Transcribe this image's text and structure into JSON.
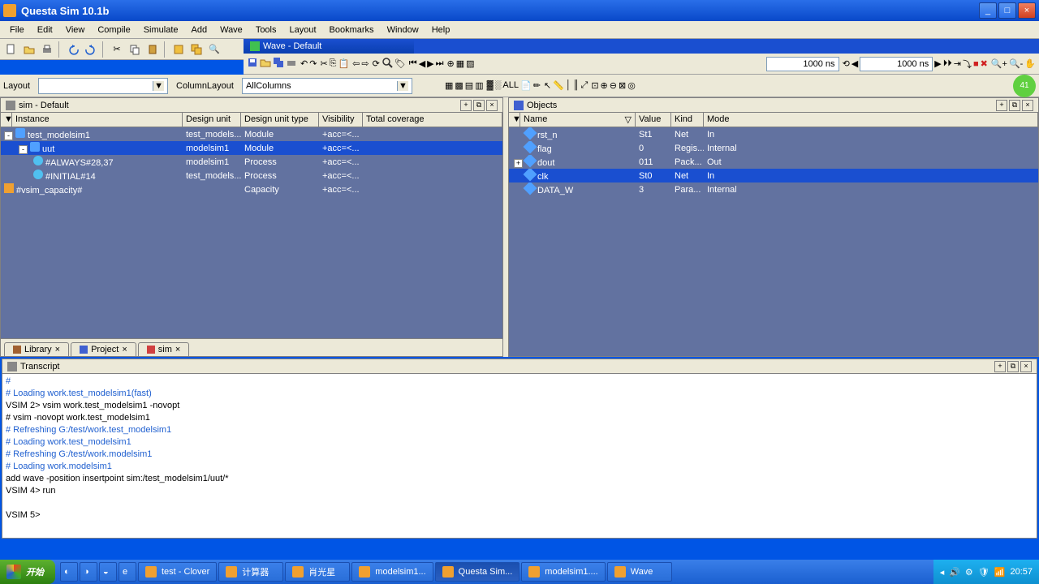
{
  "window": {
    "title": "Questa Sim 10.1b"
  },
  "menu": [
    "File",
    "Edit",
    "View",
    "Compile",
    "Simulate",
    "Add",
    "Wave",
    "Tools",
    "Layout",
    "Bookmarks",
    "Window",
    "Help"
  ],
  "wave_tab": "Wave - Default",
  "time_field_top": "1000 ns",
  "time_field_toolbar": "1000 ns",
  "layout_label": "Layout",
  "layout_value": "",
  "column_layout_label": "ColumnLayout",
  "column_layout_value": "AllColumns",
  "sim_panel": {
    "title": "sim - Default",
    "cols": [
      "Instance",
      "Design unit",
      "Design unit type",
      "Visibility",
      "Total coverage"
    ],
    "rows": [
      {
        "indent": 0,
        "exp": "-",
        "icon": "mod",
        "name": "test_modelsim1",
        "du": "test_models...",
        "dt": "Module",
        "vis": "+acc=<...",
        "sel": false
      },
      {
        "indent": 1,
        "exp": "-",
        "icon": "mod",
        "name": "uut",
        "du": "modelsim1",
        "dt": "Module",
        "vis": "+acc=<...",
        "sel": true
      },
      {
        "indent": 2,
        "exp": "",
        "icon": "proc",
        "name": "#ALWAYS#28,37",
        "du": "modelsim1",
        "dt": "Process",
        "vis": "+acc=<...",
        "sel": false
      },
      {
        "indent": 2,
        "exp": "",
        "icon": "proc",
        "name": "#INITIAL#14",
        "du": "test_models...",
        "dt": "Process",
        "vis": "+acc=<...",
        "sel": false
      },
      {
        "indent": 0,
        "exp": "",
        "icon": "cap",
        "name": "#vsim_capacity#",
        "du": "",
        "dt": "Capacity",
        "vis": "+acc=<...",
        "sel": false
      }
    ],
    "tabs": [
      "Library",
      "Project",
      "sim"
    ]
  },
  "objects_panel": {
    "title": "Objects",
    "cols": [
      "Name",
      "Value",
      "Kind",
      "Mode"
    ],
    "rows": [
      {
        "exp": "",
        "icon": "sig",
        "name": "rst_n",
        "val": "St1",
        "kind": "Net",
        "mode": "In",
        "sel": false
      },
      {
        "exp": "",
        "icon": "sig",
        "name": "flag",
        "val": "0",
        "kind": "Regis...",
        "mode": "Internal",
        "sel": false
      },
      {
        "exp": "+",
        "icon": "sig",
        "name": "dout",
        "val": "011",
        "kind": "Pack...",
        "mode": "Out",
        "sel": false
      },
      {
        "exp": "",
        "icon": "sig",
        "name": "clk",
        "val": "St0",
        "kind": "Net",
        "mode": "In",
        "sel": true
      },
      {
        "exp": "",
        "icon": "sig",
        "name": "DATA_W",
        "val": "3",
        "kind": "Para...",
        "mode": "Internal",
        "sel": false
      }
    ]
  },
  "transcript": {
    "title": "Transcript",
    "lines": [
      {
        "t": "#",
        "c": true
      },
      {
        "t": "# Loading work.test_modelsim1(fast)",
        "c": true
      },
      {
        "t": "VSIM 2> vsim work.test_modelsim1 -novopt",
        "c": false
      },
      {
        "t": "# vsim -novopt work.test_modelsim1",
        "c": false
      },
      {
        "t": "# Refreshing G:/test/work.test_modelsim1",
        "c": true
      },
      {
        "t": "# Loading work.test_modelsim1",
        "c": true
      },
      {
        "t": "# Refreshing G:/test/work.modelsim1",
        "c": true
      },
      {
        "t": "# Loading work.modelsim1",
        "c": true
      },
      {
        "t": "add wave -position insertpoint sim:/test_modelsim1/uut/*",
        "c": false
      },
      {
        "t": "VSIM 4> run",
        "c": false
      },
      {
        "t": "",
        "c": false
      },
      {
        "t": "VSIM 5>",
        "c": false
      }
    ]
  },
  "taskbar": {
    "start": "开始",
    "items": [
      {
        "label": "test - Clover",
        "active": false
      },
      {
        "label": "计算器",
        "active": false
      },
      {
        "label": "肖光星",
        "active": false
      },
      {
        "label": "modelsim1...",
        "active": false
      },
      {
        "label": "Questa Sim...",
        "active": true
      },
      {
        "label": "modelsim1....",
        "active": false
      },
      {
        "label": "Wave",
        "active": false
      }
    ],
    "time": "20:57"
  }
}
